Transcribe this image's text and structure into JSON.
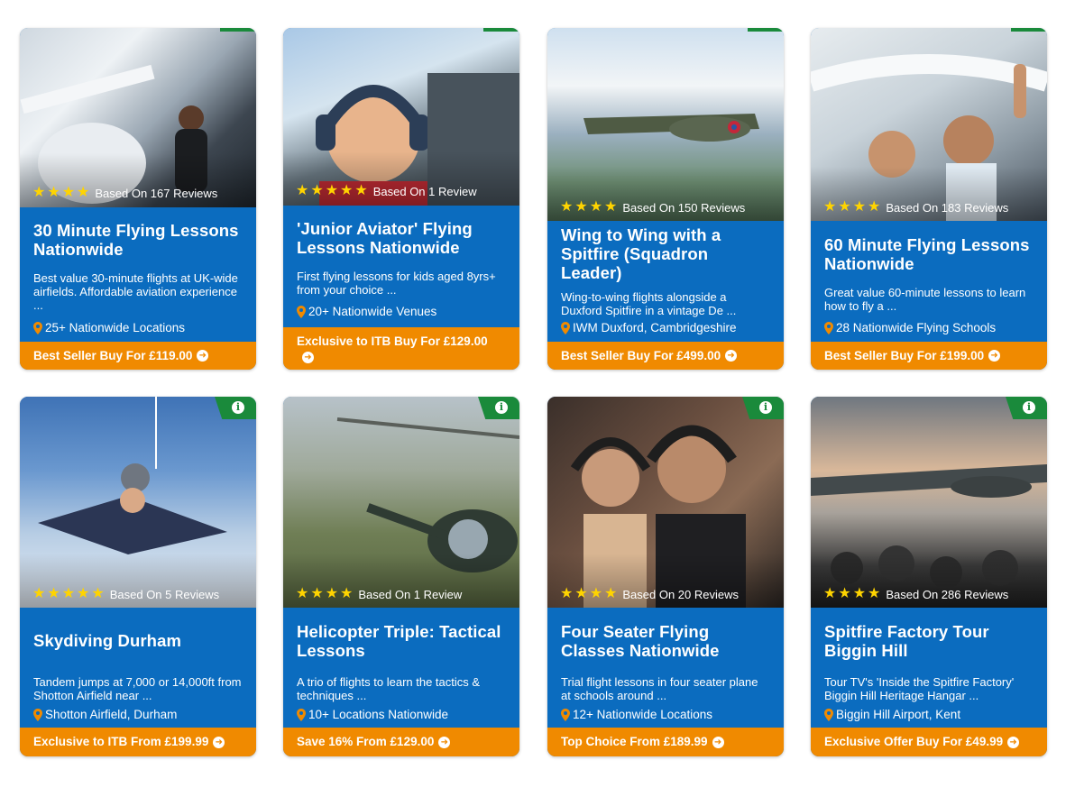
{
  "colors": {
    "card_blue": "#0b6cbf",
    "cta_orange": "#f08a00",
    "badge_green": "#1a8a3b",
    "star_yellow": "#ffd400"
  },
  "icons": {
    "rating": "star-icon",
    "location": "map-pin-icon",
    "cta": "arrow-circle-right-icon",
    "badge": "info-icon"
  },
  "cards": [
    {
      "image_alt": "Woman pilot standing by light aircraft",
      "stars": 4,
      "reviews": "Based On 167 Reviews",
      "title": "30 Minute Flying Lessons Nationwide",
      "description": "Best value 30-minute flights at UK-wide airfields. Affordable aviation experience ...",
      "location": "25+ Nationwide Locations",
      "cta": "Best Seller Buy For £119.00"
    },
    {
      "image_alt": "Boy with headset in cockpit",
      "stars": 5,
      "reviews": "Based On 1 Review",
      "title": "'Junior Aviator' Flying Lessons Nationwide",
      "description": "First flying lessons for kids aged 8yrs+ from your choice ...",
      "location": "20+ Nationwide Venues",
      "cta": "Exclusive to ITB Buy For £129.00"
    },
    {
      "image_alt": "Spitfire flying above the clouds",
      "stars": 4,
      "reviews": "Based On 150 Reviews",
      "title": "Wing to Wing with a Spitfire (Squadron Leader)",
      "description": "Wing-to-wing flights alongside a Duxford Spitfire in a vintage De ...",
      "location": "IWM Duxford, Cambridgeshire",
      "cta": "Best Seller Buy For £499.00"
    },
    {
      "image_alt": "Couple in cockpit waving",
      "stars": 4,
      "reviews": "Based On 183 Reviews",
      "title": "60 Minute Flying Lessons Nationwide",
      "description": "Great value 60-minute lessons to learn how to fly a ...",
      "location": "28 Nationwide Flying Schools",
      "cta": "Best Seller Buy For £199.00"
    },
    {
      "image_alt": "Tandem skydivers in freefall",
      "stars": 5,
      "reviews": "Based On 5 Reviews",
      "title": "Skydiving Durham",
      "description": "Tandem jumps at 7,000 or 14,000ft from Shotton Airfield near ...",
      "location": "Shotton Airfield, Durham",
      "cta": "Exclusive to ITB From £199.99"
    },
    {
      "image_alt": "Helicopter flying over countryside",
      "stars": 4,
      "reviews": "Based On 1 Review",
      "title": "Helicopter Triple: Tactical Lessons",
      "description": "A trio of flights to learn the tactics & techniques ...",
      "location": "10+ Locations Nationwide",
      "cta": "Save 16% From £129.00"
    },
    {
      "image_alt": "Smiling couple wearing headsets in aircraft",
      "stars": 4,
      "reviews": "Based On 20 Reviews",
      "title": "Four Seater Flying Classes Nationwide",
      "description": "Trial flight lessons in four seater plane at schools around ...",
      "location": "12+ Nationwide Locations",
      "cta": "Top Choice From £189.99"
    },
    {
      "image_alt": "Visitors in Spitfire hangar",
      "stars": 4,
      "reviews": "Based On 286 Reviews",
      "title": "Spitfire Factory Tour Biggin Hill",
      "description": "Tour TV's 'Inside the Spitfire Factory' Biggin Hill Heritage Hangar ...",
      "location": "Biggin Hill Airport, Kent",
      "cta": "Exclusive Offer Buy For £49.99"
    }
  ]
}
